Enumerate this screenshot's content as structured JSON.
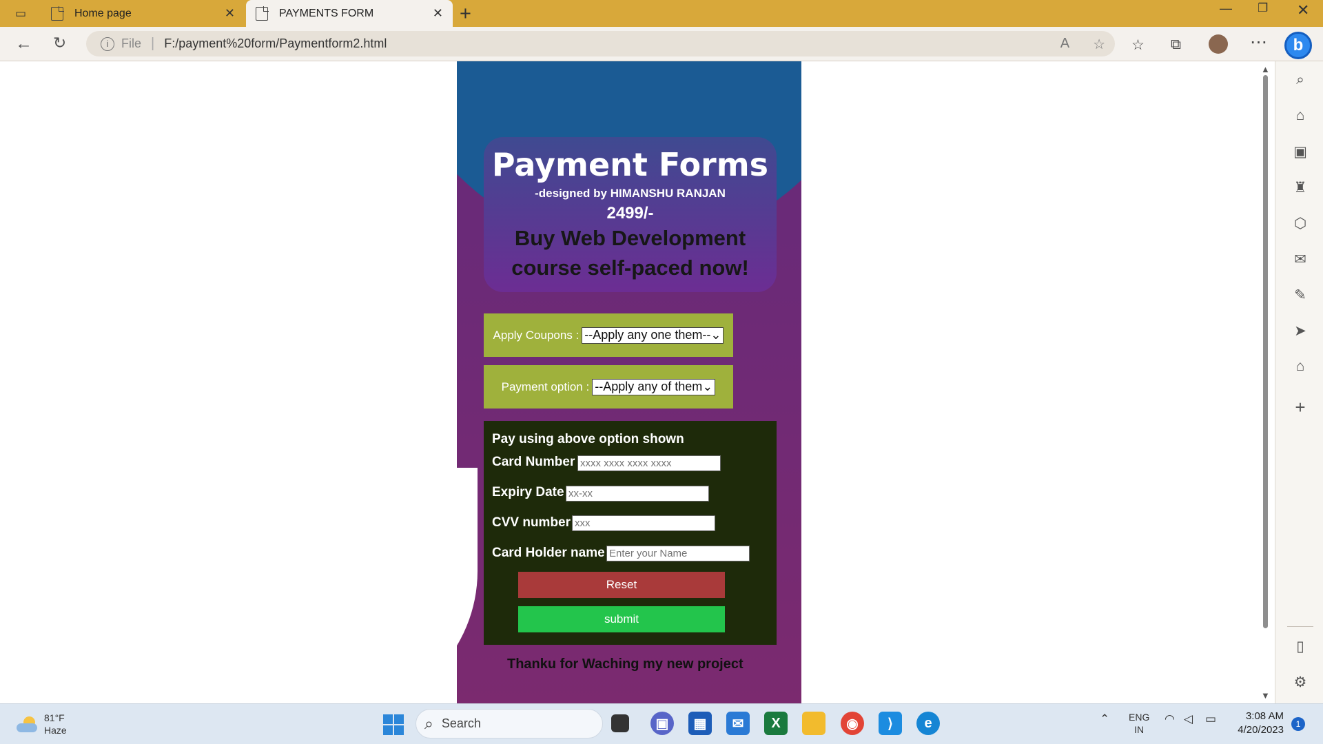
{
  "browser": {
    "tabs": [
      {
        "title": "Home page",
        "active": false
      },
      {
        "title": "PAYMENTS FORM",
        "active": true
      }
    ],
    "address": {
      "scheme_label": "File",
      "url": "F:/payment%20form/Paymentform2.html"
    }
  },
  "page": {
    "title": "Payment Forms",
    "designed_by": "-designed by HIMANSHU RANJAN",
    "price": "2499/-",
    "headline": "Buy Web Development course self-paced now!",
    "coupons": {
      "label": "Apply Coupons :",
      "selected": "--Apply any one them--"
    },
    "payment": {
      "label": "Payment option :",
      "selected": "--Apply any of them"
    },
    "card_section": {
      "heading": "Pay using above option shown",
      "card_number_label": "Card Number",
      "card_number_placeholder": "xxxx xxxx xxxx xxxx",
      "expiry_label": "Expiry Date",
      "expiry_placeholder": "xx-xx",
      "cvv_label": "CVV number",
      "cvv_placeholder": "xxx",
      "holder_label": "Card Holder name",
      "holder_placeholder": "Enter your Name",
      "reset_label": "Reset",
      "submit_label": "submit"
    },
    "footer": "Thanku for Waching my new project",
    "colors": {
      "top_blue": "#1b5b94",
      "purple": "#6a2a78",
      "green_panel": "#9fb13c",
      "reset": "#a93a3a",
      "submit": "#23c54c"
    }
  },
  "taskbar": {
    "weather": {
      "temp": "81°F",
      "condition": "Haze"
    },
    "search_label": "Search",
    "language": {
      "top": "ENG",
      "bottom": "IN"
    },
    "time": "3:08 AM",
    "date": "4/20/2023",
    "notifications": "1"
  }
}
